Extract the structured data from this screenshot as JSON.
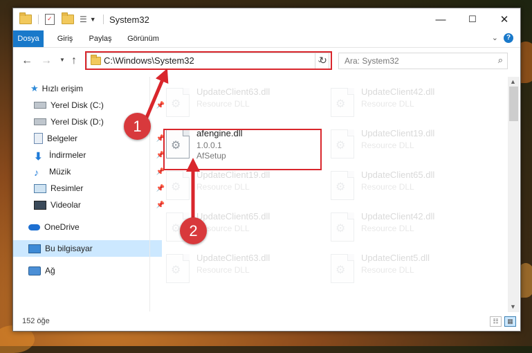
{
  "window": {
    "title": "System32",
    "controls": {
      "minimize": "—",
      "maximize": "☐",
      "close": "✕"
    }
  },
  "ribbon": {
    "tabs": [
      "Dosya",
      "Giriş",
      "Paylaş",
      "Görünüm"
    ],
    "help": "?"
  },
  "nav": {
    "address": "C:\\Windows\\System32",
    "search_placeholder": "Ara: System32"
  },
  "sidebar": {
    "items": [
      {
        "label": "Hızlı erişim",
        "icon": "star-icon"
      },
      {
        "label": "Yerel Disk (C:)",
        "icon": "drive-icon"
      },
      {
        "label": "Yerel Disk (D:)",
        "icon": "drive-icon"
      },
      {
        "label": "Belgeler",
        "icon": "documents-icon"
      },
      {
        "label": "İndirmeler",
        "icon": "download-icon"
      },
      {
        "label": "Müzik",
        "icon": "music-icon"
      },
      {
        "label": "Resimler",
        "icon": "pictures-icon"
      },
      {
        "label": "Videolar",
        "icon": "videos-icon"
      },
      {
        "label": "OneDrive",
        "icon": "cloud-icon"
      },
      {
        "label": "Bu bilgisayar",
        "icon": "computer-icon"
      },
      {
        "label": "Ağ",
        "icon": "network-icon"
      }
    ]
  },
  "files": {
    "highlighted": {
      "name": "afengine.dll",
      "version": "1.0.0.1",
      "company": "AfSetup"
    },
    "faded": [
      {
        "name": "UpdateClient63.dll",
        "type": "Resource DLL"
      },
      {
        "name": "UpdateClient42.dll",
        "type": "Resource DLL"
      },
      {
        "name": "UpdateClient19.dll",
        "type": "Resource DLL"
      },
      {
        "name": "UpdateClient19.dll",
        "type": "Resource DLL"
      },
      {
        "name": "UpdateClient65.dll",
        "type": "Resource DLL"
      },
      {
        "name": "UpdateClient65.dll",
        "type": "Resource DLL"
      },
      {
        "name": "UpdateClient42.dll",
        "type": "Resource DLL"
      },
      {
        "name": "UpdateClient63.dll",
        "type": "Resource DLL"
      },
      {
        "name": "UpdateClient5.dll",
        "type": "Resource DLL"
      }
    ]
  },
  "status": {
    "count": "152 öğe"
  },
  "annotations": {
    "step1": "1",
    "step2": "2",
    "color": "#d9262c"
  }
}
